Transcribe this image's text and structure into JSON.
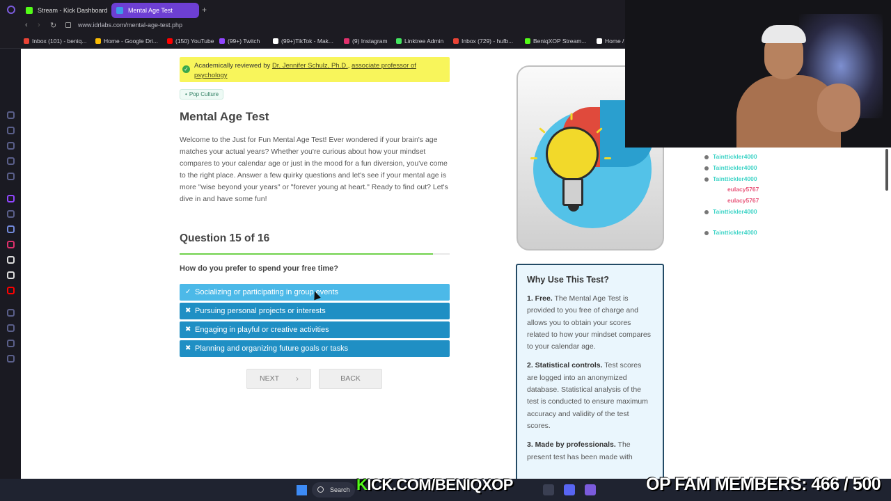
{
  "browser": {
    "tabs": [
      {
        "label": "Stream - Kick Dashboard",
        "color": "#53fc18"
      },
      {
        "label": "Mental Age Test",
        "color": "#3d9be9"
      }
    ],
    "new_tab": "+",
    "url": "www.idrlabs.com/mental-age-test.php",
    "bookmarks": [
      {
        "label": "Inbox (101) - beniq...",
        "color": "#ea4335"
      },
      {
        "label": "Home - Google Dri...",
        "color": "#fbbc04"
      },
      {
        "label": "(150) YouTube",
        "color": "#ff0000"
      },
      {
        "label": "(99+) Twitch",
        "color": "#9146ff"
      },
      {
        "label": "(99+)TikTok - Mak...",
        "color": "#ffffff"
      },
      {
        "label": "(9) Instagram",
        "color": "#e1306c"
      },
      {
        "label": "Linktree Admin",
        "color": "#43e660"
      },
      {
        "label": "Inbox (729) - hufb...",
        "color": "#ea4335"
      },
      {
        "label": "BeniqXOP Stream...",
        "color": "#53fc18"
      },
      {
        "label": "Home /",
        "color": "#ffffff"
      }
    ]
  },
  "page": {
    "review": {
      "prefix": "Academically reviewed by",
      "reviewer": "Dr. Jennifer Schulz, Ph.D.",
      "separator": ",",
      "role": "associate professor of psychology"
    },
    "tag": "Pop Culture",
    "title": "Mental Age Test",
    "intro": "Welcome to the Just for Fun Mental Age Test! Ever wondered if your brain's age matches your actual years? Whether you're curious about how your mindset compares to your calendar age or just in the mood for a fun diversion, you've come to the right place. Answer a few quirky questions and let's see if your mental age is more \"wise beyond your years\" or \"forever young at heart.\" Ready to find out? Let's dive in and have some fun!",
    "question_number": "Question 15 of 16",
    "progress_fraction": 0.9375,
    "question": "How do you prefer to spend your free time?",
    "answers": [
      {
        "label": "Socializing or participating in group events",
        "mark": "✓",
        "selected": true
      },
      {
        "label": "Pursuing personal projects or interests",
        "mark": "✖",
        "selected": false
      },
      {
        "label": "Engaging in playful or creative activities",
        "mark": "✖",
        "selected": false
      },
      {
        "label": "Planning and organizing future goals or tasks",
        "mark": "✖",
        "selected": false
      }
    ],
    "next_label": "NEXT",
    "next_arrow": "›",
    "back_label": "BACK",
    "why": {
      "title": "Why Use This Test?",
      "items": [
        {
          "heading": "1. Free.",
          "text": " The Mental Age Test is provided to you free of charge and allows you to obtain your scores related to how your mindset compares to your calendar age."
        },
        {
          "heading": "2. Statistical controls.",
          "text": " Test scores are logged into an anonymized database. Statistical analysis of the test is conducted to ensure maximum accuracy and validity of the test scores."
        },
        {
          "heading": "3. Made by professionals.",
          "text": " The present test has been made with"
        }
      ]
    }
  },
  "chat": [
    {
      "user": "Tainttickler4000",
      "color": "teal"
    },
    {
      "user": "Tainttickler4000",
      "color": "teal"
    },
    {
      "user": "Tainttickler4000",
      "color": "teal"
    },
    {
      "user": "eulacy5767",
      "color": "pink"
    },
    {
      "user": "eulacy5767",
      "color": "pink"
    },
    {
      "user": "Tainttickler4000",
      "color": "teal"
    },
    {
      "user": "Tainttickler4000",
      "color": "teal"
    }
  ],
  "taskbar": {
    "search": "Search",
    "overlay_left_k": "K",
    "overlay_left_rest": "ICK.COM/BENIQXOP",
    "overlay_right": "OP FAM MEMBERS: 466 / 500"
  }
}
